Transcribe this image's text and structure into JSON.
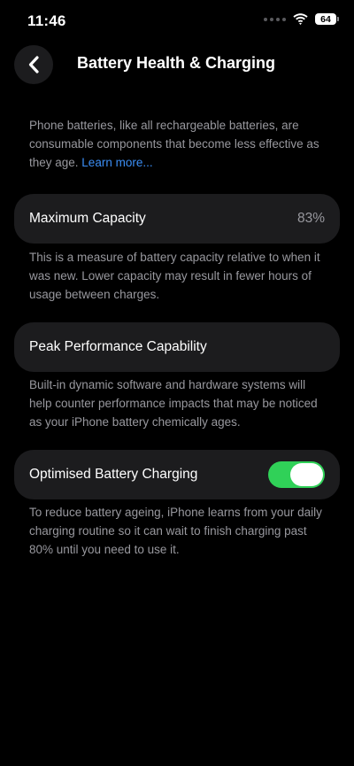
{
  "status_bar": {
    "time": "11:46",
    "battery_level": "64",
    "icons": [
      "signal-dots-icon",
      "wifi-icon",
      "battery-icon"
    ]
  },
  "nav": {
    "title": "Battery Health & Charging",
    "back_icon": "chevron-left-icon"
  },
  "intro": {
    "text": "Phone batteries, like all rechargeable batteries, are consumable components that become less effective as they age. ",
    "link": "Learn more..."
  },
  "maximum_capacity": {
    "label": "Maximum Capacity",
    "value": "83%",
    "footnote": "This is a measure of battery capacity relative to when it was new. Lower capacity may result in fewer hours of usage between charges."
  },
  "peak_performance": {
    "label": "Peak Performance Capability",
    "footnote": "Built-in dynamic software and hardware systems will help counter performance impacts that may be noticed as your iPhone battery chemically ages."
  },
  "optimised_charging": {
    "label": "Optimised Battery Charging",
    "enabled": true,
    "footnote": "To reduce battery ageing, iPhone learns from your daily charging routine so it can wait to finish charging past 80% until you need to use it."
  },
  "colors": {
    "background": "#000000",
    "cell": "#1c1c1e",
    "secondary_text": "#98989e",
    "link": "#3b8ef5",
    "toggle_on": "#30d158"
  }
}
